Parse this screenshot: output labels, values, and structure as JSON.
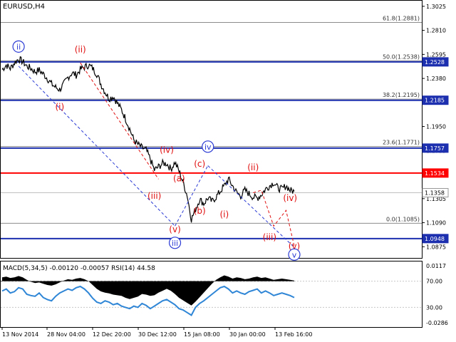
{
  "symbol_label": "EURUSD,H4",
  "indicator_label": "MACD(5,34,5) -0.00120 -0.00057 RSI(14) 44.58",
  "colors": {
    "price": "#000000",
    "blue_level": "#1c2fae",
    "red_level": "#ff0000",
    "fib_level": "#8c8c8c",
    "wave_blue": "#2b3bd4",
    "wave_red": "#e01010",
    "rsi": "#2f86d6",
    "macd_fill": "#000000",
    "current_price_line": "#c0c0c0",
    "badge_text": "#ffffff"
  },
  "chart_data": {
    "type": "line",
    "title": "EURUSD,H4",
    "ylim": [
      1.0775,
      1.3075
    ],
    "grid": false,
    "x_tick_labels": [
      "13 Nov 2014",
      "28 Nov 04:00",
      "12 Dec 20:00",
      "30 Dec 12:00",
      "15 Jan 08:00",
      "30 Jan 00:00",
      "13 Feb 16:00"
    ],
    "y_tick_labels": [
      "1.3025",
      "1.2810",
      "1.2595",
      "1.2380",
      "1.2165",
      "1.1950",
      "1.1735",
      "1.1520",
      "1.1305",
      "1.1090",
      "1.0875"
    ],
    "price_series": {
      "name": "EURUSD",
      "values": [
        1.246,
        1.25,
        1.247,
        1.252,
        1.2555,
        1.253,
        1.249,
        1.247,
        1.244,
        1.2455,
        1.242,
        1.238,
        1.233,
        1.23,
        1.228,
        1.233,
        1.239,
        1.243,
        1.241,
        1.246,
        1.248,
        1.25,
        1.247,
        1.242,
        1.233,
        1.226,
        1.22,
        1.222,
        1.216,
        1.21,
        1.202,
        1.193,
        1.183,
        1.179,
        1.176,
        1.174,
        1.166,
        1.156,
        1.159,
        1.162,
        1.162,
        1.157,
        1.163,
        1.155,
        1.145,
        1.133,
        1.112,
        1.121,
        1.13,
        1.126,
        1.131,
        1.128,
        1.132,
        1.137,
        1.142,
        1.148,
        1.142,
        1.136,
        1.133,
        1.138,
        1.135,
        1.132,
        1.131,
        1.134,
        1.139,
        1.142,
        1.145,
        1.14,
        1.139,
        1.142,
        1.138,
        1.137
      ]
    },
    "horizontal_levels": [
      {
        "value": 1.2528,
        "label": "1.2528",
        "kind": "blue"
      },
      {
        "value": 1.2185,
        "label": "1.2185",
        "kind": "blue"
      },
      {
        "value": 1.1757,
        "label": "1.1757",
        "kind": "blue"
      },
      {
        "value": 1.1534,
        "label": "1.1534",
        "kind": "red"
      },
      {
        "value": 1.0948,
        "label": "1.0948",
        "kind": "blue"
      },
      {
        "value": 1.1358,
        "label": "1.1358",
        "kind": "current"
      }
    ],
    "fibonacci_levels": [
      {
        "value": 1.2881,
        "label": "61.8(1.2881)"
      },
      {
        "value": 1.2538,
        "label": "50.0(1.2538)"
      },
      {
        "value": 1.2195,
        "label": "38.2(1.2195)"
      },
      {
        "value": 1.1771,
        "label": "23.6(1.1771)"
      },
      {
        "value": 1.1085,
        "label": "0.0(1.1085)"
      }
    ],
    "wave_labels": [
      {
        "text": "ii",
        "style": "blue-circle",
        "bar": 4,
        "price": 1.2665
      },
      {
        "text": "(ii)",
        "style": "red",
        "bar": 19,
        "price": 1.264
      },
      {
        "text": "(i)",
        "style": "red",
        "bar": 14,
        "price": 1.2125
      },
      {
        "text": "(iv)",
        "style": "red",
        "bar": 40,
        "price": 1.174
      },
      {
        "text": "iv",
        "style": "blue-circle",
        "bar": 50,
        "price": 1.177
      },
      {
        "text": "(a)",
        "style": "red",
        "bar": 43,
        "price": 1.1485
      },
      {
        "text": "(c)",
        "style": "red",
        "bar": 48,
        "price": 1.1615
      },
      {
        "text": "(iii)",
        "style": "red",
        "bar": 37,
        "price": 1.133
      },
      {
        "text": "(b)",
        "style": "red",
        "bar": 48,
        "price": 1.1195
      },
      {
        "text": "(v)",
        "style": "red",
        "bar": 42,
        "price": 1.103
      },
      {
        "text": "iii",
        "style": "blue-circle",
        "bar": 42,
        "price": 1.091
      },
      {
        "text": "(i)",
        "style": "red",
        "bar": 54,
        "price": 1.1165
      },
      {
        "text": "(ii)",
        "style": "red",
        "bar": 61,
        "price": 1.1585
      },
      {
        "text": "(iv)",
        "style": "red",
        "bar": 70,
        "price": 1.131
      },
      {
        "text": "(iii)",
        "style": "red",
        "bar": 65,
        "price": 1.096
      },
      {
        "text": "(v)",
        "style": "red",
        "bar": 71,
        "price": 1.088
      },
      {
        "text": "v",
        "style": "blue-circle",
        "bar": 71,
        "price": 1.0805
      }
    ],
    "forecast_path": {
      "name": "projection",
      "points": [
        {
          "bar": 61,
          "price": 1.1358
        },
        {
          "bar": 63,
          "price": 1.138
        },
        {
          "bar": 66,
          "price": 1.106
        },
        {
          "bar": 69,
          "price": 1.12
        },
        {
          "bar": 71,
          "price": 1.088
        }
      ]
    },
    "indicator": {
      "macd_label": "MACD(5,34,5)",
      "macd_values": [
        -0.0012,
        -0.00057
      ],
      "rsi_label": "RSI(14)",
      "rsi_value": 44.58,
      "axis_labels": [
        "0.0117",
        "70.00",
        "30.00",
        "-0.0286"
      ],
      "rsi_levels": [
        70,
        30
      ],
      "ylim": [
        0,
        100
      ],
      "rsi_series": [
        55,
        58,
        52,
        54,
        60,
        58,
        50,
        48,
        47,
        52,
        45,
        42,
        40,
        47,
        52,
        55,
        58,
        56,
        60,
        62,
        58,
        52,
        44,
        38,
        36,
        40,
        38,
        34,
        36,
        32,
        30,
        28,
        32,
        30,
        36,
        33,
        28,
        32,
        36,
        40,
        42,
        38,
        34,
        28,
        26,
        22,
        18,
        30,
        36,
        40,
        45,
        50,
        55,
        60,
        62,
        58,
        52,
        55,
        52,
        50,
        54,
        56,
        58,
        52,
        55,
        52,
        48,
        50,
        52,
        50,
        48,
        45
      ],
      "macd_series": [
        0.6,
        0.7,
        0.5,
        0.6,
        0.8,
        0.6,
        0.2,
        -0.1,
        -0.3,
        -0.2,
        -0.4,
        -0.6,
        -0.7,
        -0.5,
        -0.2,
        0.1,
        0.3,
        0.2,
        0.4,
        0.5,
        0.3,
        0.0,
        -0.6,
        -1.2,
        -1.6,
        -1.8,
        -1.9,
        -2.1,
        -2.2,
        -2.3,
        -2.6,
        -2.8,
        -2.6,
        -2.4,
        -2.0,
        -2.1,
        -2.3,
        -2.2,
        -1.8,
        -1.5,
        -1.2,
        -1.5,
        -2.0,
        -2.6,
        -3.0,
        -3.4,
        -3.8,
        -3.2,
        -2.5,
        -1.8,
        -1.1,
        -0.4,
        0.2,
        0.6,
        0.9,
        0.7,
        0.4,
        0.6,
        0.5,
        0.3,
        0.4,
        0.6,
        0.7,
        0.5,
        0.6,
        0.4,
        0.2,
        0.3,
        0.4,
        0.3,
        0.2,
        0.1
      ]
    }
  }
}
